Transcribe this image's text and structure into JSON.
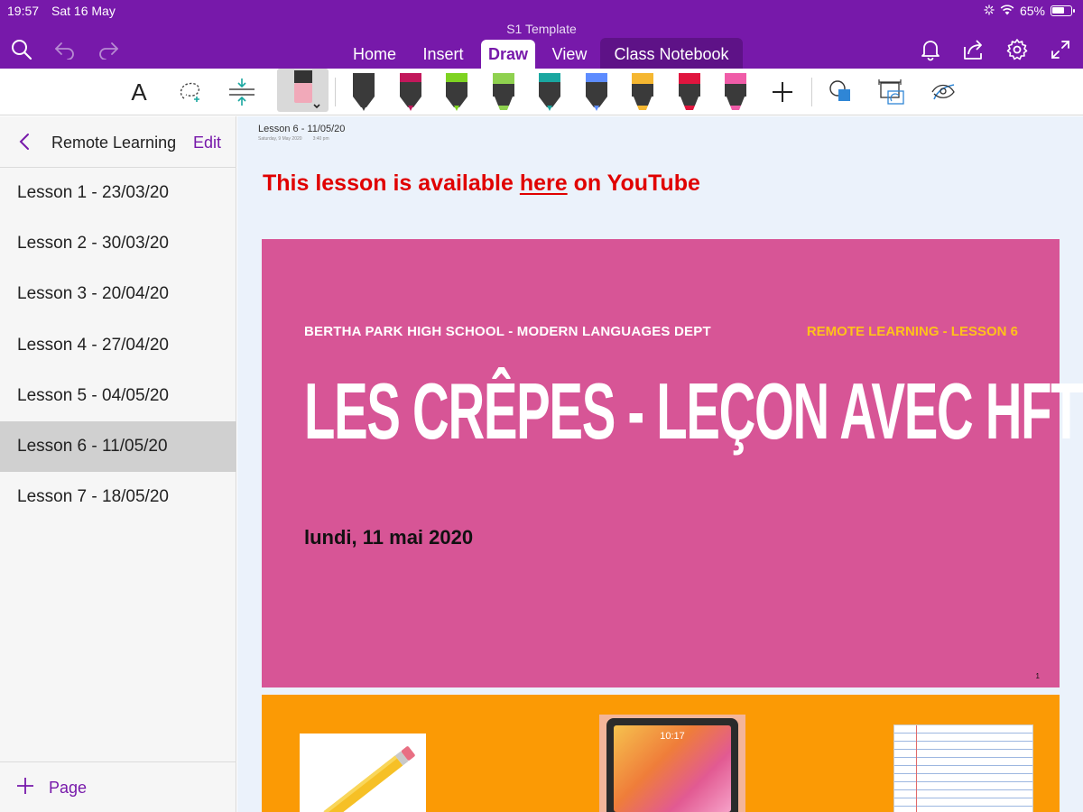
{
  "status_bar": {
    "time": "19:57",
    "date": "Sat 16 May",
    "battery": "65%"
  },
  "app": {
    "doc_title": "S1 Template"
  },
  "tabs": [
    {
      "label": "Home"
    },
    {
      "label": "Insert"
    },
    {
      "label": "Draw",
      "active": true
    },
    {
      "label": "View"
    },
    {
      "label": "Class Notebook"
    }
  ],
  "ribbon": {
    "text_tool": "A",
    "pens": [
      {
        "name": "pen-black",
        "color": "#3a3a3a"
      },
      {
        "name": "pen-magenta",
        "color": "#c2185b"
      },
      {
        "name": "pen-green",
        "color": "#7ed321"
      },
      {
        "name": "highlighter-green",
        "color": "#8fd14f"
      },
      {
        "name": "pen-teal",
        "color": "#1aa7a0"
      },
      {
        "name": "pen-galaxy",
        "color": "#5d8cff"
      },
      {
        "name": "highlighter-yellow",
        "color": "#f5b731"
      },
      {
        "name": "highlighter-red",
        "color": "#e0153e"
      },
      {
        "name": "highlighter-pink",
        "color": "#f05ca8"
      }
    ]
  },
  "sidebar": {
    "section_title": "Remote Learning",
    "edit_label": "Edit",
    "pages": [
      {
        "label": "Lesson 1 - 23/03/20"
      },
      {
        "label": "Lesson 2 - 30/03/20"
      },
      {
        "label": "Lesson 3 - 20/04/20"
      },
      {
        "label": "Lesson 4 - 27/04/20"
      },
      {
        "label": "Lesson 5 - 04/05/20"
      },
      {
        "label": "Lesson 6 - 11/05/20",
        "selected": true
      },
      {
        "label": "Lesson 7 - 18/05/20"
      }
    ],
    "add_page_label": "Page"
  },
  "page": {
    "title": "Lesson 6 - 11/05/20",
    "meta_date": "Saturday, 9 May 2020",
    "meta_time": "3:40 pm",
    "banner": {
      "before": "This lesson is available ",
      "link": "here",
      "after": " on YouTube"
    }
  },
  "slide1": {
    "school": "BERTHA PARK HIGH SCHOOL - MODERN LANGUAGES DEPT",
    "remote": "REMOTE LEARNING - LESSON 6",
    "title": "LES CRÊPES - LEÇON AVEC HFTT",
    "date": "lundi, 11 mai 2020",
    "slide_number": "1"
  },
  "slide2": {
    "ipad_time": "10:17"
  },
  "colors": {
    "accent": "#7719aa",
    "slide1_bg": "#d75596",
    "slide2_bg": "#fb9a05",
    "link_red": "#e00000",
    "remote_yellow": "#ffc21a"
  }
}
